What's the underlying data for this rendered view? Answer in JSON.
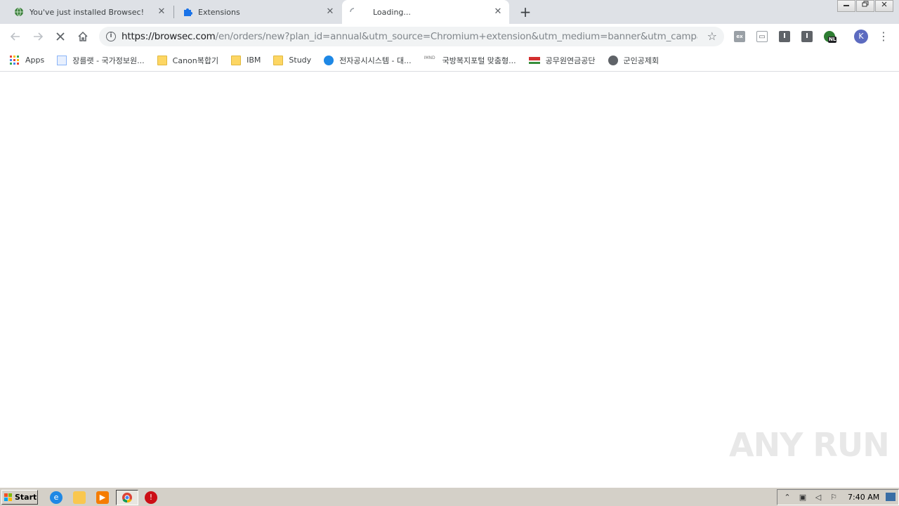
{
  "tabs": [
    {
      "title": "You've just installed Browsec!",
      "icon": "globe-icon"
    },
    {
      "title": "Extensions",
      "icon": "puzzle-icon"
    },
    {
      "title": "Loading...",
      "icon": "spinner-icon"
    }
  ],
  "tab_close_glyph": "✕",
  "new_tab_glyph": "+",
  "toolbar": {
    "url_host": "https://browsec.com",
    "url_path": "/en/orders/new?plan_id=annual&utm_source=Chromium+extension&utm_medium=banner&utm_campaign=...",
    "avatar_letter": "K",
    "ext_nl_badge": "NL"
  },
  "bookmarks": [
    {
      "label": "Apps",
      "icon": "apps-grid-icon"
    },
    {
      "label": "장를랫 - 국가정보원...",
      "icon": "page-icon"
    },
    {
      "label": "Canon복합기",
      "icon": "folder-icon"
    },
    {
      "label": "IBM",
      "icon": "folder-icon"
    },
    {
      "label": "Study",
      "icon": "folder-icon"
    },
    {
      "label": "전자공시시스템 - 대...",
      "icon": "dart-icon"
    },
    {
      "label": "국방복지포털 맞춤형...",
      "icon": "imnd-icon"
    },
    {
      "label": "공무원연금공단",
      "icon": "pension-icon"
    },
    {
      "label": "군인공제회",
      "icon": "globe-icon"
    }
  ],
  "watermark": "ANY RUN",
  "taskbar": {
    "start_label": "Start",
    "clock": "7:40 AM"
  },
  "colors": {
    "tabstrip": "#dee1e6",
    "omnibox": "#f1f3f4",
    "taskbar": "#d4d0c8",
    "accent_blue": "#1a73e8"
  }
}
